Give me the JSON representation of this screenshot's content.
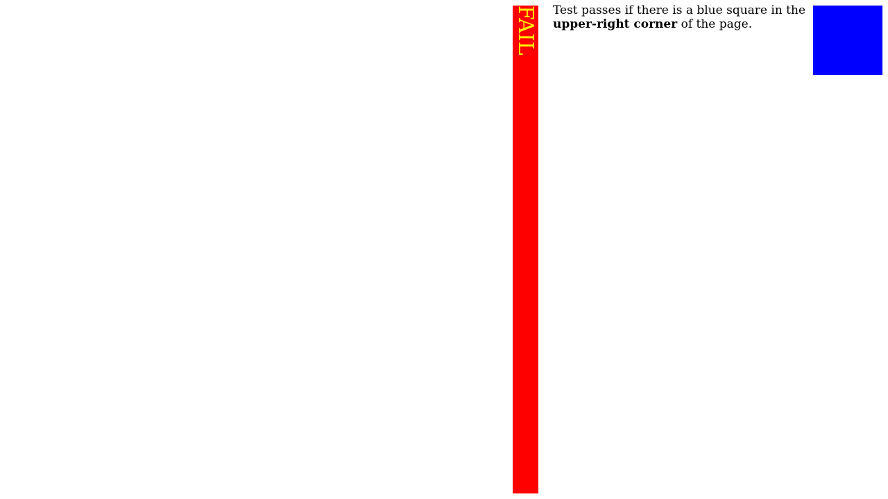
{
  "fail_bar": {
    "label": "FAIL",
    "background_color": "#ff0000",
    "text_color": "#ffff00"
  },
  "instructions": {
    "text_before": "Test passes if there is a blue square in the ",
    "emphasis": "upper-right corner",
    "text_after": " of the page."
  },
  "blue_square": {
    "color": "#0000ff"
  }
}
